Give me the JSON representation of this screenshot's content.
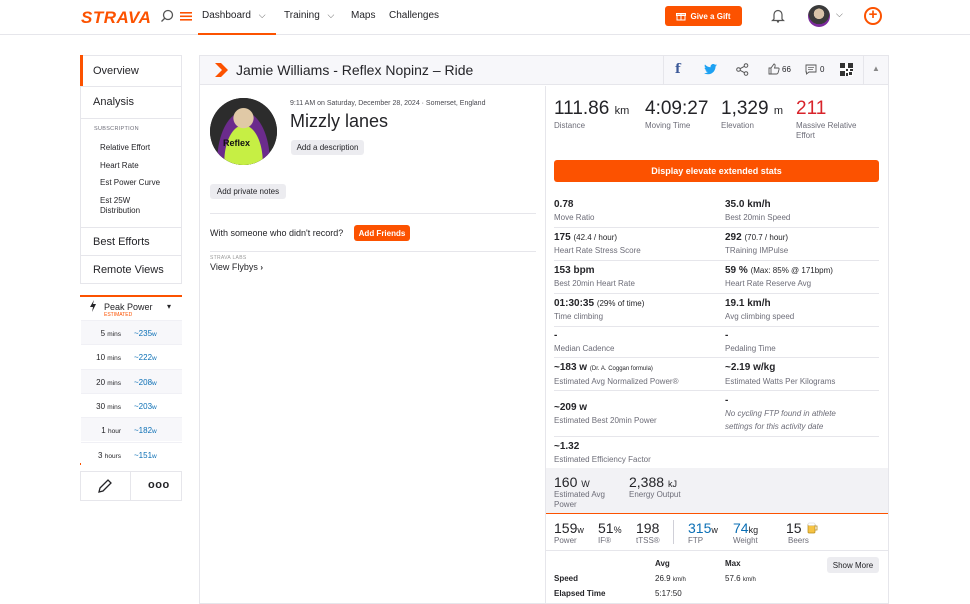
{
  "nav": {
    "logo": "STRAVA",
    "dashboard": "Dashboard",
    "training": "Training",
    "maps": "Maps",
    "challenges": "Challenges",
    "gift": "Give a Gift"
  },
  "sidebar": {
    "overview": "Overview",
    "analysis": "Analysis",
    "subscription": "SUBSCRIPTION",
    "links": [
      "Relative Effort",
      "Heart Rate",
      "Est Power Curve",
      "Est 25W",
      "Distribution"
    ],
    "best_efforts": "Best Efforts",
    "remote_views": "Remote Views",
    "peak_power": "Peak Power",
    "estimated": "ESTIMATED",
    "peaks": [
      {
        "n": "5",
        "u": "mins",
        "v": "~235",
        "w": "w"
      },
      {
        "n": "10",
        "u": "mins",
        "v": "~222",
        "w": "w"
      },
      {
        "n": "20",
        "u": "mins",
        "v": "~208",
        "w": "w"
      },
      {
        "n": "30",
        "u": "mins",
        "v": "~203",
        "w": "w"
      },
      {
        "n": "1",
        "u": "hour",
        "v": "~182",
        "w": "w"
      },
      {
        "n": "3",
        "u": "hours",
        "v": "~151",
        "w": "w"
      }
    ]
  },
  "activity": {
    "header": "Jamie Williams - Reflex Nopinz – Ride",
    "kudos": "66",
    "comments": "0",
    "meta": "9:11 AM on Saturday, December 28, 2024 · Somerset, England",
    "name": "Mizzly lanes",
    "add_description": "Add a description",
    "add_private_notes": "Add private notes",
    "someone": "With someone who didn't record?",
    "add_friends": "Add Friends",
    "labs": "STRAVA LABS",
    "view_flybys": "View Flybys",
    "badge": "Reflex"
  },
  "summary": {
    "distance": "111.86",
    "distance_unit": "km",
    "distance_lbl": "Distance",
    "moving": "4:09:27",
    "moving_lbl": "Moving Time",
    "elevation": "1,329",
    "elevation_unit": "m",
    "elevation_lbl": "Elevation",
    "effort": "211",
    "effort_lbl1": "Massive Relative",
    "effort_lbl2": "Effort"
  },
  "elevate_btn": "Display elevate extended stats",
  "elevate": {
    "r1": {
      "lv": "0.78",
      "ll": "Move Ratio",
      "rv": "35.0 km/h",
      "rl": "Best 20min Speed"
    },
    "r2": {
      "lv": "175",
      "lvs": "(42.4 / hour)",
      "ll": "Heart Rate Stress Score",
      "rv": "292",
      "rvs": "(70.7 / hour)",
      "rl": "TRaining IMPulse"
    },
    "r3": {
      "lv": "153 bpm",
      "ll": "Best 20min Heart Rate",
      "rv": "59 %",
      "rvs": "(Max: 85% @ 171bpm)",
      "rl": "Heart Rate Reserve Avg"
    },
    "r4": {
      "lv": "01:30:35",
      "lvs": "(29% of time)",
      "ll": "Time climbing",
      "rv": "19.1 km/h",
      "rl": "Avg climbing speed"
    },
    "r5": {
      "lv": "-",
      "ll": "Median Cadence",
      "rv": "-",
      "rl": "Pedaling Time"
    },
    "r6": {
      "lv": "~183 w",
      "lvs": "(Dr. A. Coggan formula)",
      "ll": "Estimated Avg Normalized Power®",
      "rv": "~2.19 w/kg",
      "rl": "Estimated Watts Per Kilograms"
    },
    "r7": {
      "lv": "~209 w",
      "ll": "Estimated Best 20min Power",
      "rv": "-",
      "rl1": "No cycling FTP found in athlete",
      "rl2": "settings for this activity date"
    },
    "r8": {
      "lv": "~1.32",
      "ll": "Estimated Efficiency Factor"
    }
  },
  "power": {
    "avg": "160",
    "avg_unit": "W",
    "avg_lbl1": "Estimated Avg",
    "avg_lbl2": "Power",
    "energy": "2,388",
    "energy_unit": "kJ",
    "energy_lbl": "Energy Output"
  },
  "bottom": {
    "power": "159",
    "power_u": "w",
    "power_l": "Power",
    "if": "51",
    "if_u": "%",
    "if_l": "IF®",
    "tss": "198",
    "tss_l": "tTSS®",
    "ftp": "315",
    "ftp_u": "w",
    "ftp_l": "FTP",
    "weight": "74",
    "weight_u": "kg",
    "weight_l": "Weight",
    "beers": "15",
    "beers_l": "Beers"
  },
  "table": {
    "avg": "Avg",
    "max": "Max",
    "show_more": "Show More",
    "speed": "Speed",
    "speed_avg": "26.9",
    "speed_max": "57.6",
    "kmh": "km/h",
    "elapsed": "Elapsed Time",
    "elapsed_avg": "5:17:50"
  },
  "colors": {
    "accent": "#fc5200",
    "link": "#0b6fb5",
    "effort": "#d8232a"
  }
}
